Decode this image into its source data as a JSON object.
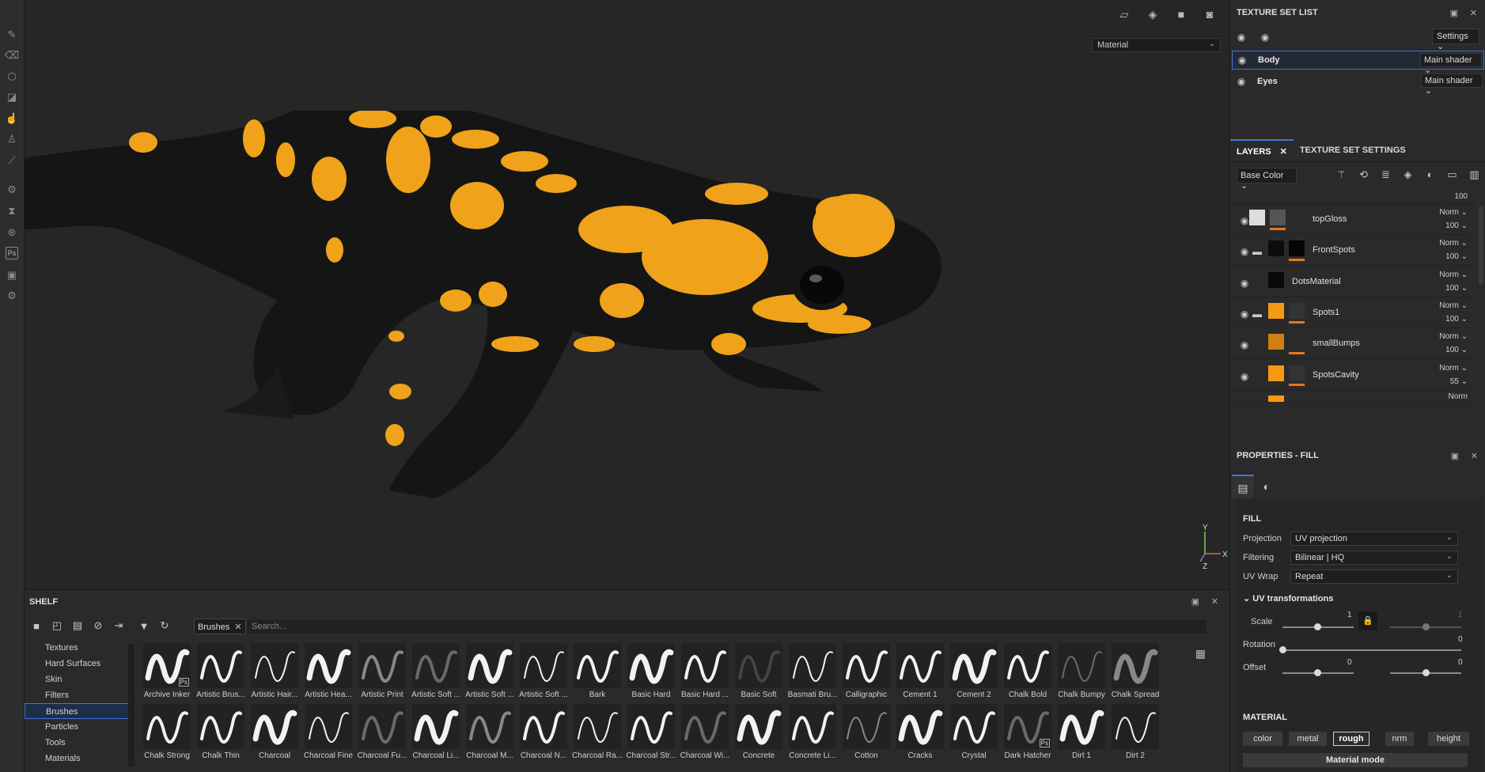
{
  "toolbar": {
    "icons": [
      "brush-icon",
      "eraser-icon",
      "projection-icon",
      "polygon-fill-icon",
      "smudge-icon",
      "clone-icon",
      "color-picker-icon",
      "bake-icon",
      "material-picker-icon",
      "physics-icon",
      "photoshop-icon",
      "export-icon",
      "settings-icon"
    ],
    "ps_label": "Ps"
  },
  "viewport": {
    "material_mode": "Material",
    "gizmo": {
      "y": "Y",
      "x": "X",
      "z": "Z"
    }
  },
  "shelf": {
    "title": "SHELF",
    "filter_tag": "Brushes",
    "search_placeholder": "Search...",
    "categories": [
      "Textures",
      "Hard Surfaces",
      "Skin",
      "Filters",
      "Brushes",
      "Particles",
      "Tools",
      "Materials"
    ],
    "selected_category": "Brushes",
    "brushes": [
      {
        "label": "Archive Inker",
        "ps": "Ps"
      },
      {
        "label": "Artistic Brus..."
      },
      {
        "label": "Artistic Hair..."
      },
      {
        "label": "Artistic Hea..."
      },
      {
        "label": "Artistic Print"
      },
      {
        "label": "Artistic Soft ..."
      },
      {
        "label": "Artistic Soft ..."
      },
      {
        "label": "Artistic Soft ..."
      },
      {
        "label": "Bark"
      },
      {
        "label": "Basic Hard"
      },
      {
        "label": "Basic Hard ..."
      },
      {
        "label": "Basic Soft"
      },
      {
        "label": "Basmati Bru..."
      },
      {
        "label": "Calligraphic"
      },
      {
        "label": "Cement 1"
      },
      {
        "label": "Cement 2"
      },
      {
        "label": "Chalk Bold"
      },
      {
        "label": "Chalk Bumpy"
      },
      {
        "label": "Chalk Spread"
      },
      {
        "label": "Chalk Strong"
      },
      {
        "label": "Chalk Thin"
      },
      {
        "label": "Charcoal"
      },
      {
        "label": "Charcoal Fine"
      },
      {
        "label": "Charcoal Fu..."
      },
      {
        "label": "Charcoal Li..."
      },
      {
        "label": "Charcoal M..."
      },
      {
        "label": "Charcoal N..."
      },
      {
        "label": "Charcoal Ra..."
      },
      {
        "label": "Charcoal Str..."
      },
      {
        "label": "Charcoal Wi..."
      },
      {
        "label": "Concrete"
      },
      {
        "label": "Concrete Li..."
      },
      {
        "label": "Cotton"
      },
      {
        "label": "Cracks"
      },
      {
        "label": "Crystal"
      },
      {
        "label": "Dark Hatcher",
        "ps": "Ps"
      },
      {
        "label": "Dirt 1"
      },
      {
        "label": "Dirt 2"
      }
    ]
  },
  "texture_set_list": {
    "title": "TEXTURE SET LIST",
    "settings_label": "Settings",
    "sets": [
      {
        "name": "Body",
        "shader": "Main shader"
      },
      {
        "name": "Eyes",
        "shader": "Main shader"
      }
    ]
  },
  "layers": {
    "tab_layers": "LAYERS",
    "tab_tss": "TEXTURE SET SETTINGS",
    "channel": "Base Color",
    "top_opacity": "100",
    "items": [
      {
        "name": "topGloss",
        "blend": "Norm",
        "opacity": "100",
        "folder": false
      },
      {
        "name": "FrontSpots",
        "blend": "Norm",
        "opacity": "100",
        "folder": true
      },
      {
        "name": "DotsMaterial",
        "blend": "Norm",
        "opacity": "100",
        "folder": false
      },
      {
        "name": "Spots1",
        "blend": "Norm",
        "opacity": "100",
        "folder": true
      },
      {
        "name": "smallBumps",
        "blend": "Norm",
        "opacity": "100",
        "folder": false
      },
      {
        "name": "SpotsCavity",
        "blend": "Norm",
        "opacity": "55",
        "folder": false
      }
    ],
    "partial_blend": "Norm"
  },
  "properties": {
    "title": "PROPERTIES - FILL",
    "fill_section": "FILL",
    "projection_label": "Projection",
    "projection_value": "UV projection",
    "filtering_label": "Filtering",
    "filtering_value": "Bilinear | HQ",
    "uvwrap_label": "UV Wrap",
    "uvwrap_value": "Repeat",
    "uvt_section": "UV transformations",
    "scale_label": "Scale",
    "scale_value": "1",
    "scale_value2": "1",
    "rotation_label": "Rotation",
    "rotation_value": "0",
    "offset_label": "Offset",
    "offset_value1": "0",
    "offset_value2": "0",
    "material_section": "MATERIAL",
    "channels": [
      "color",
      "metal",
      "rough",
      "nrm",
      "height"
    ],
    "active_channel": "rough",
    "material_mode": "Material mode"
  },
  "colors": {
    "accent": "#3c76d6",
    "spot": "#f0a21a",
    "skin": "#141414"
  }
}
